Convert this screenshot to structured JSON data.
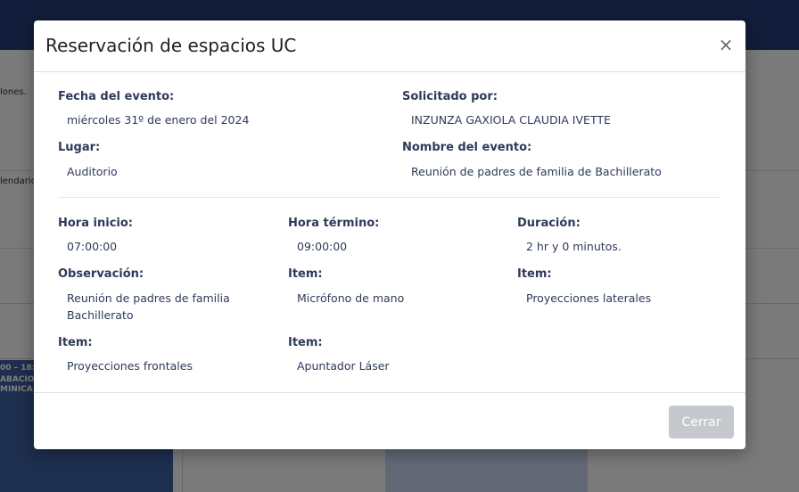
{
  "background": {
    "snippet_top": "lones.",
    "snippet_mid": "lendario",
    "event_time": "00 – 18:",
    "event_line1": "ABACIO",
    "event_line2": "MINICA"
  },
  "modal": {
    "title": "Reservación de espacios UC",
    "close_icon": "×",
    "fields": {
      "fecha": {
        "label": "Fecha del evento:",
        "value": "miércoles 31º de enero del 2024"
      },
      "solicitado": {
        "label": "Solicitado por:",
        "value": "INZUNZA GAXIOLA CLAUDIA IVETTE"
      },
      "lugar": {
        "label": "Lugar:",
        "value": "Auditorio"
      },
      "nombre": {
        "label": "Nombre del evento:",
        "value": "Reunión de padres de familia de Bachillerato"
      },
      "hora_inicio": {
        "label": "Hora inicio:",
        "value": "07:00:00"
      },
      "hora_termino": {
        "label": "Hora término:",
        "value": "09:00:00"
      },
      "duracion": {
        "label": "Duración:",
        "value": "2 hr y 0 minutos."
      },
      "observacion": {
        "label": "Observación:",
        "value_line1": "Reunión de padres de familia",
        "value_line2": "Bachillerato"
      },
      "item1": {
        "label": "Item:",
        "value": "Micrófono de mano"
      },
      "item2": {
        "label": "Item:",
        "value": "Proyecciones laterales"
      },
      "item3": {
        "label": "Item:",
        "value": "Proyecciones frontales"
      },
      "item4": {
        "label": "Item:",
        "value": "Apuntador Láser"
      }
    },
    "footer": {
      "close_button": "Cerrar"
    }
  }
}
